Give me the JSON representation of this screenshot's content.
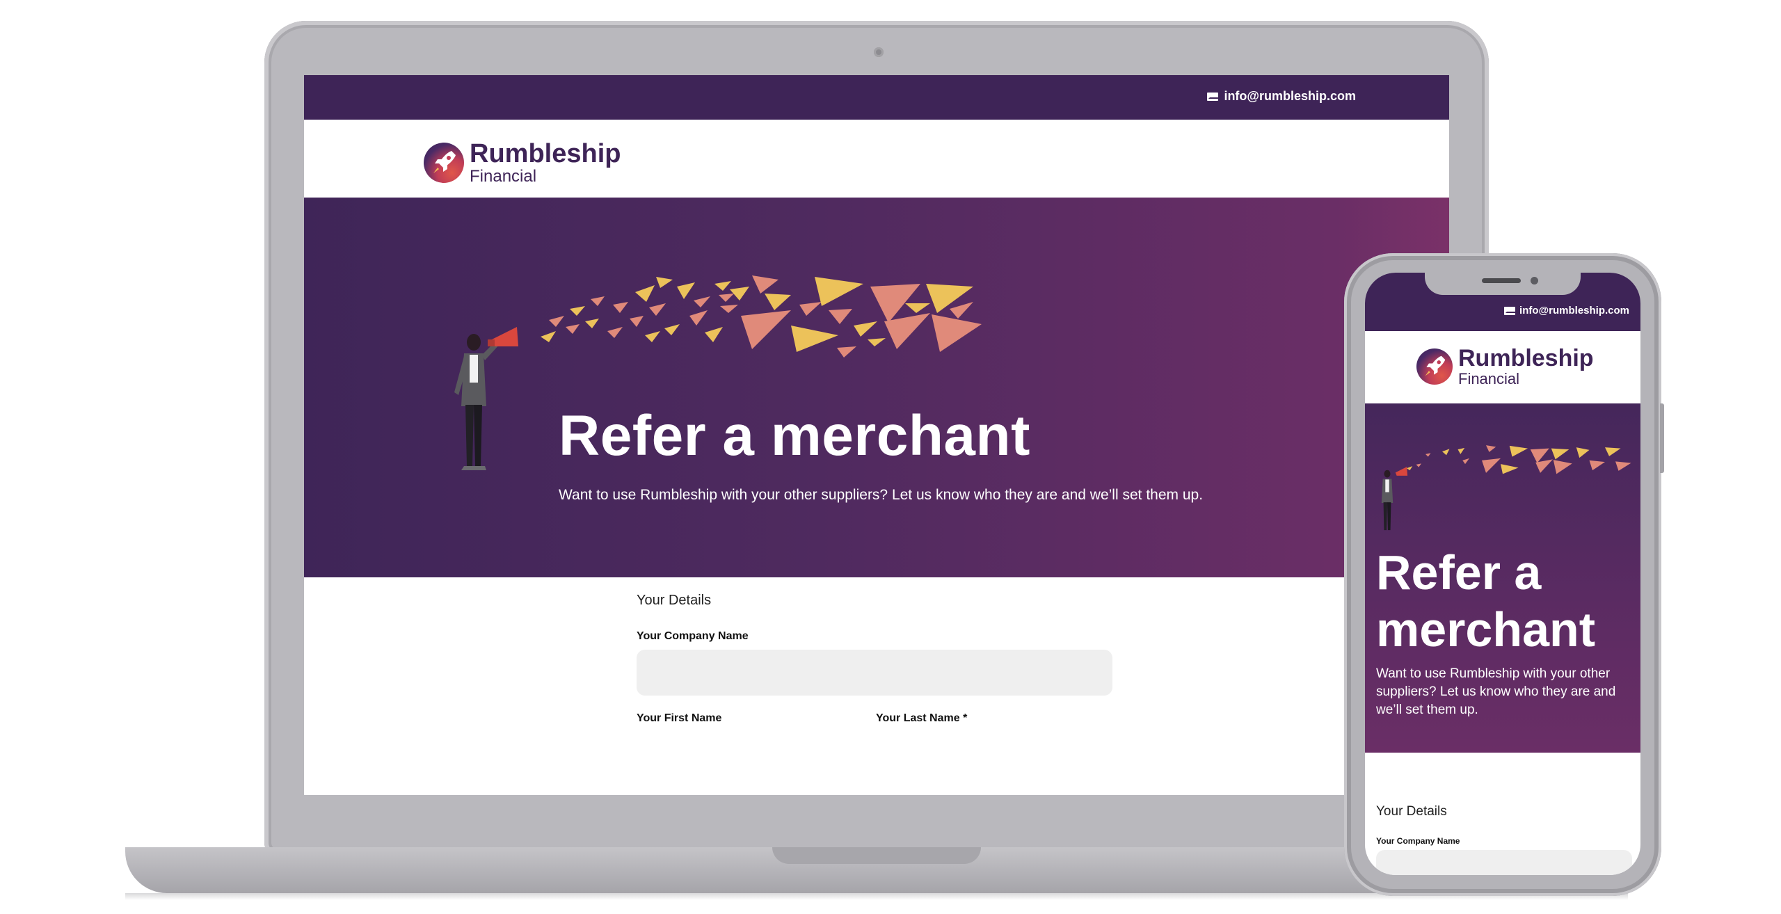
{
  "site": {
    "email": "info@rumbleship.com",
    "brand_name": "Rumbleship",
    "brand_sub": "Financial",
    "colors": {
      "topbar": "#3e2457",
      "hero_start": "#3f2558",
      "hero_end": "#7a3168",
      "plane_yellow": "#ecc25a",
      "plane_pink": "#e08a7a"
    }
  },
  "hero": {
    "title": "Refer a merchant",
    "subtitle": "Want to use Rumbleship with your other suppliers? Let us know who they are and we’ll set them up."
  },
  "form": {
    "section_heading": "Your Details",
    "company_label": "Your Company Name",
    "company_value": "",
    "first_name_label": "Your First Name",
    "last_name_label": "Your Last Name *"
  },
  "mobile": {
    "title_line1": "Refer a",
    "title_line2": "merchant"
  },
  "icons": [
    "envelope-icon",
    "rocket-logo-icon",
    "megaphone-illustration",
    "paper-plane-icon"
  ]
}
